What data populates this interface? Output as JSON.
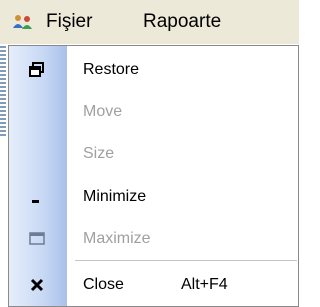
{
  "menubar": {
    "items": [
      {
        "label": "Fişier"
      },
      {
        "label": "Rapoarte"
      }
    ]
  },
  "system_menu": {
    "items": [
      {
        "label": "Restore",
        "enabled": true,
        "icon": "restore-icon"
      },
      {
        "label": "Move",
        "enabled": false
      },
      {
        "label": "Size",
        "enabled": false
      },
      {
        "label": "Minimize",
        "enabled": true,
        "icon": "minimize-icon"
      },
      {
        "label": "Maximize",
        "enabled": false,
        "icon": "maximize-icon"
      },
      {
        "label": "Close",
        "enabled": true,
        "icon": "close-icon",
        "shortcut": "Alt+F4"
      }
    ]
  },
  "colors": {
    "menubar_bg": "#ece9d8",
    "gutter_blue": "#a9c1ea",
    "disabled_text": "#a0a0a0"
  }
}
